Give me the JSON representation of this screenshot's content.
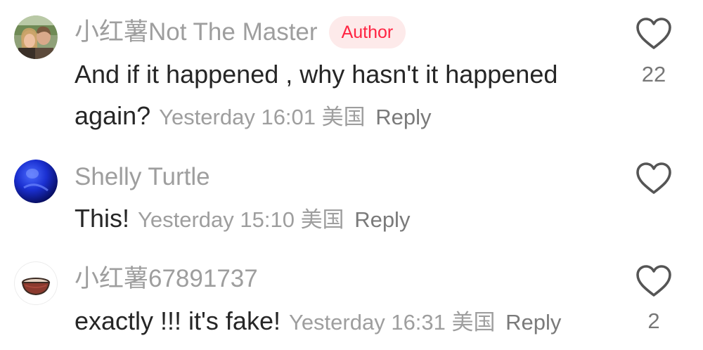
{
  "comments": [
    {
      "username": "小红薯Not The Master",
      "badge": "Author",
      "text": "And if it happened , why hasn't it happened again?",
      "timestamp": "Yesterday 16:01",
      "location": "美国",
      "reply_label": "Reply",
      "like_count": "22",
      "avatar_icon": "photo-avatar-couple"
    },
    {
      "username": "Shelly Turtle",
      "text": "This!",
      "timestamp": "Yesterday 15:10",
      "location": "美国",
      "reply_label": "Reply",
      "like_count": "",
      "avatar_icon": "photo-avatar-blue"
    },
    {
      "username": "小红薯67891737",
      "text": "exactly !!! it's fake!",
      "timestamp": "Yesterday 16:31",
      "location": "美国",
      "reply_label": "Reply",
      "like_count": "2",
      "avatar_icon": "bowl-avatar"
    }
  ],
  "colors": {
    "author_badge_bg": "#fdeaea",
    "author_badge_text": "#ff2442",
    "username": "#9e9e9e",
    "body": "#262626",
    "meta": "#9e9e9e"
  },
  "icons": {
    "like": "heart-outline-icon"
  }
}
